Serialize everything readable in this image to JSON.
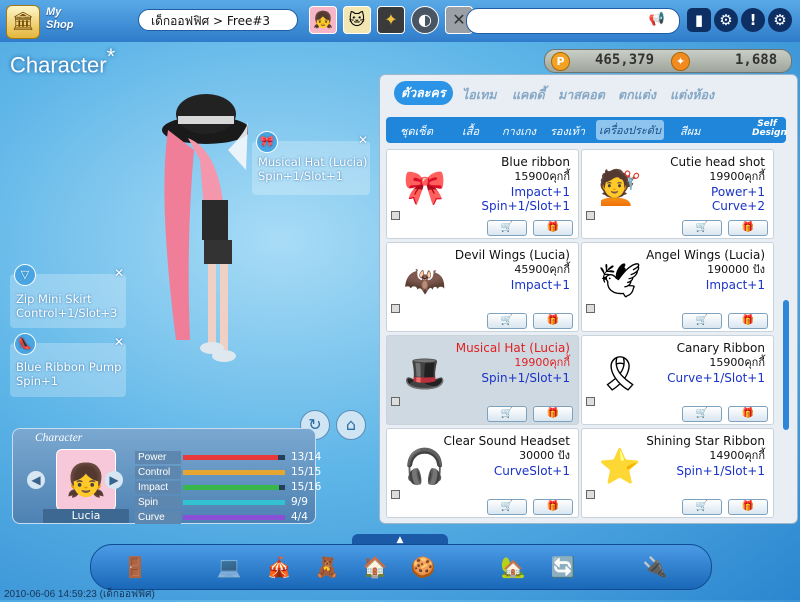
{
  "topbar": {
    "myshop_label": "My Shop",
    "channel": "เด็กออฟฟิศ > Free#3",
    "search_value": ""
  },
  "title": "Character",
  "title_star": "*",
  "currency": {
    "cash": "465,379",
    "points": "1,688"
  },
  "equipped": {
    "hat": {
      "name": "Musical Hat (Lucia)",
      "stat": "Spin+1/Slot+1"
    },
    "skirt": {
      "name": "Zip Mini Skirt",
      "stat": "Control+1/Slot+3"
    },
    "shoes": {
      "name": "Blue Ribbon Pump",
      "stat": "Spin+1"
    }
  },
  "character_panel": {
    "title": "Character",
    "name": "Lucia",
    "stats": [
      {
        "label": "Power",
        "value": "13/14",
        "fraction": 0.93,
        "color": "#e83a3a"
      },
      {
        "label": "Control",
        "value": "15/15",
        "fraction": 1.0,
        "color": "#e7a531"
      },
      {
        "label": "Impact",
        "value": "15/16",
        "fraction": 0.94,
        "color": "#38b84a"
      },
      {
        "label": "Spin",
        "value": "9/9",
        "fraction": 1.0,
        "color": "#33c2d0"
      },
      {
        "label": "Curve",
        "value": "4/4",
        "fraction": 1.0,
        "color": "#8a4fd6"
      }
    ]
  },
  "shop": {
    "tabs": [
      "ตัวละคร",
      "ไอเทม",
      "แคดดี้",
      "มาสคอต",
      "ตกแต่ง",
      "แต่งห้อง"
    ],
    "subtabs": [
      "ชุดเซ็ต",
      "เสื้อ",
      "กางเกง",
      "รองเท้า",
      "เครื่องประดับ",
      "สีผม"
    ],
    "self_design": "Self Design",
    "items": [
      {
        "name": "Blue ribbon",
        "price": "15900คุกกี้",
        "stats": [
          "Impact+1",
          "Spin+1/Slot+1"
        ],
        "icon": "🎀"
      },
      {
        "name": "Cutie head shot",
        "price": "19900คุกกี้",
        "stats": [
          "Power+1",
          "Curve+2"
        ],
        "icon": "💇"
      },
      {
        "name": "Devil Wings (Lucia)",
        "price": "45900คุกกี้",
        "stats": [
          "Impact+1"
        ],
        "icon": "🦇"
      },
      {
        "name": "Angel Wings (Lucia)",
        "price": "190000 ปัง",
        "stats": [
          "Impact+1"
        ],
        "icon": "🕊"
      },
      {
        "name": "Musical Hat (Lucia)",
        "price": "19900คุกกี้",
        "stats": [
          "Spin+1/Slot+1"
        ],
        "icon": "🎩"
      },
      {
        "name": "Canary Ribbon",
        "price": "15900คุกกี้",
        "stats": [
          "Curve+1/Slot+1"
        ],
        "icon": "🎗"
      },
      {
        "name": "Clear Sound Headset",
        "price": "30000 ปัง",
        "stats": [
          "CurveSlot+1"
        ],
        "icon": "🎧"
      },
      {
        "name": "Shining Star Ribbon",
        "price": "14900คุกกี้",
        "stats": [
          "Spin+1/Slot+1"
        ],
        "icon": "⭐"
      }
    ],
    "cart_icon": "🛒",
    "gift_icon": "🎁"
  },
  "dock": {
    "collapse": "▲",
    "icons": [
      "🚪",
      "💻",
      "🎪",
      "🧸",
      "🏠",
      "🍪",
      "🏡",
      "🔄",
      "🔌"
    ]
  },
  "timestamp": "2010-06-06 14:59:23 (เด็กออฟฟิศ)"
}
